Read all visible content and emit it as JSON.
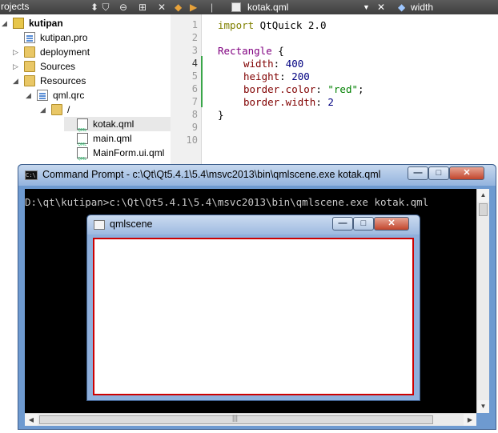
{
  "project_pane": {
    "title": "rojects",
    "toolbar_icons": [
      "chevron-down-icon",
      "filter-icon",
      "link-icon",
      "split-add-icon",
      "close-icon"
    ],
    "tree": [
      {
        "label": "kutipan",
        "level": 0,
        "expanded": true,
        "icon": "project-icon",
        "bold": true
      },
      {
        "label": "kutipan.pro",
        "level": 1,
        "icon": "pro-file-icon"
      },
      {
        "label": "deployment",
        "level": 1,
        "expanded": false,
        "icon": "folder-icon"
      },
      {
        "label": "Sources",
        "level": 1,
        "expanded": false,
        "icon": "sources-folder-icon"
      },
      {
        "label": "Resources",
        "level": 1,
        "expanded": true,
        "icon": "resources-folder-icon"
      },
      {
        "label": "qml.qrc",
        "level": 2,
        "expanded": true,
        "icon": "qrc-file-icon"
      },
      {
        "label": "/",
        "level": 3,
        "expanded": true,
        "icon": "folder-icon"
      },
      {
        "label": "kotak.qml",
        "level": 4,
        "icon": "qml-file-icon",
        "selected": true
      },
      {
        "label": "main.qml",
        "level": 4,
        "icon": "qml-file-icon"
      },
      {
        "label": "MainForm.ui.qml",
        "level": 4,
        "icon": "qml-file-icon"
      }
    ]
  },
  "editor": {
    "nav_back": "◆",
    "nav_forward": "▶",
    "file_tab": "kotak.qml",
    "symbol": "width",
    "line_numbers": [
      "1",
      "2",
      "3",
      "4",
      "5",
      "6",
      "7",
      "8",
      "9",
      "10"
    ],
    "code_tokens": {
      "l1_kw": "import",
      "l1_rest": " QtQuick 2.0",
      "l3_type": "Rectangle",
      "l3_rest": " {",
      "l4_prop": "width",
      "l4_sep": ": ",
      "l4_val": "400",
      "l5_prop": "height",
      "l5_sep": ": ",
      "l5_val": "200",
      "l6_prop": "border.color",
      "l6_sep": ": ",
      "l6_val": "\"red\"",
      "l6_end": ";",
      "l7_prop": "border.width",
      "l7_sep": ": ",
      "l7_val": "2",
      "l8": "}"
    }
  },
  "cmd_window": {
    "title": "Command Prompt - c:\\Qt\\Qt5.4.1\\5.4\\msvc2013\\bin\\qmlscene.exe  kotak.qml",
    "icon_text": "C:\\",
    "console_line": "D:\\qt\\kutipan>c:\\Qt\\Qt5.4.1\\5.4\\msvc2013\\bin\\qmlscene.exe kotak.qml",
    "buttons": {
      "minimize": "—",
      "maximize": "□",
      "close": "✕"
    },
    "scroll": {
      "up": "▲",
      "down": "▼",
      "left": "◀",
      "right": "▶",
      "grip": "|||"
    }
  },
  "qml_window": {
    "title": "qmlscene",
    "buttons": {
      "minimize": "—",
      "maximize": "□",
      "close": "✕"
    },
    "rect_border_color": "#cc0000"
  }
}
